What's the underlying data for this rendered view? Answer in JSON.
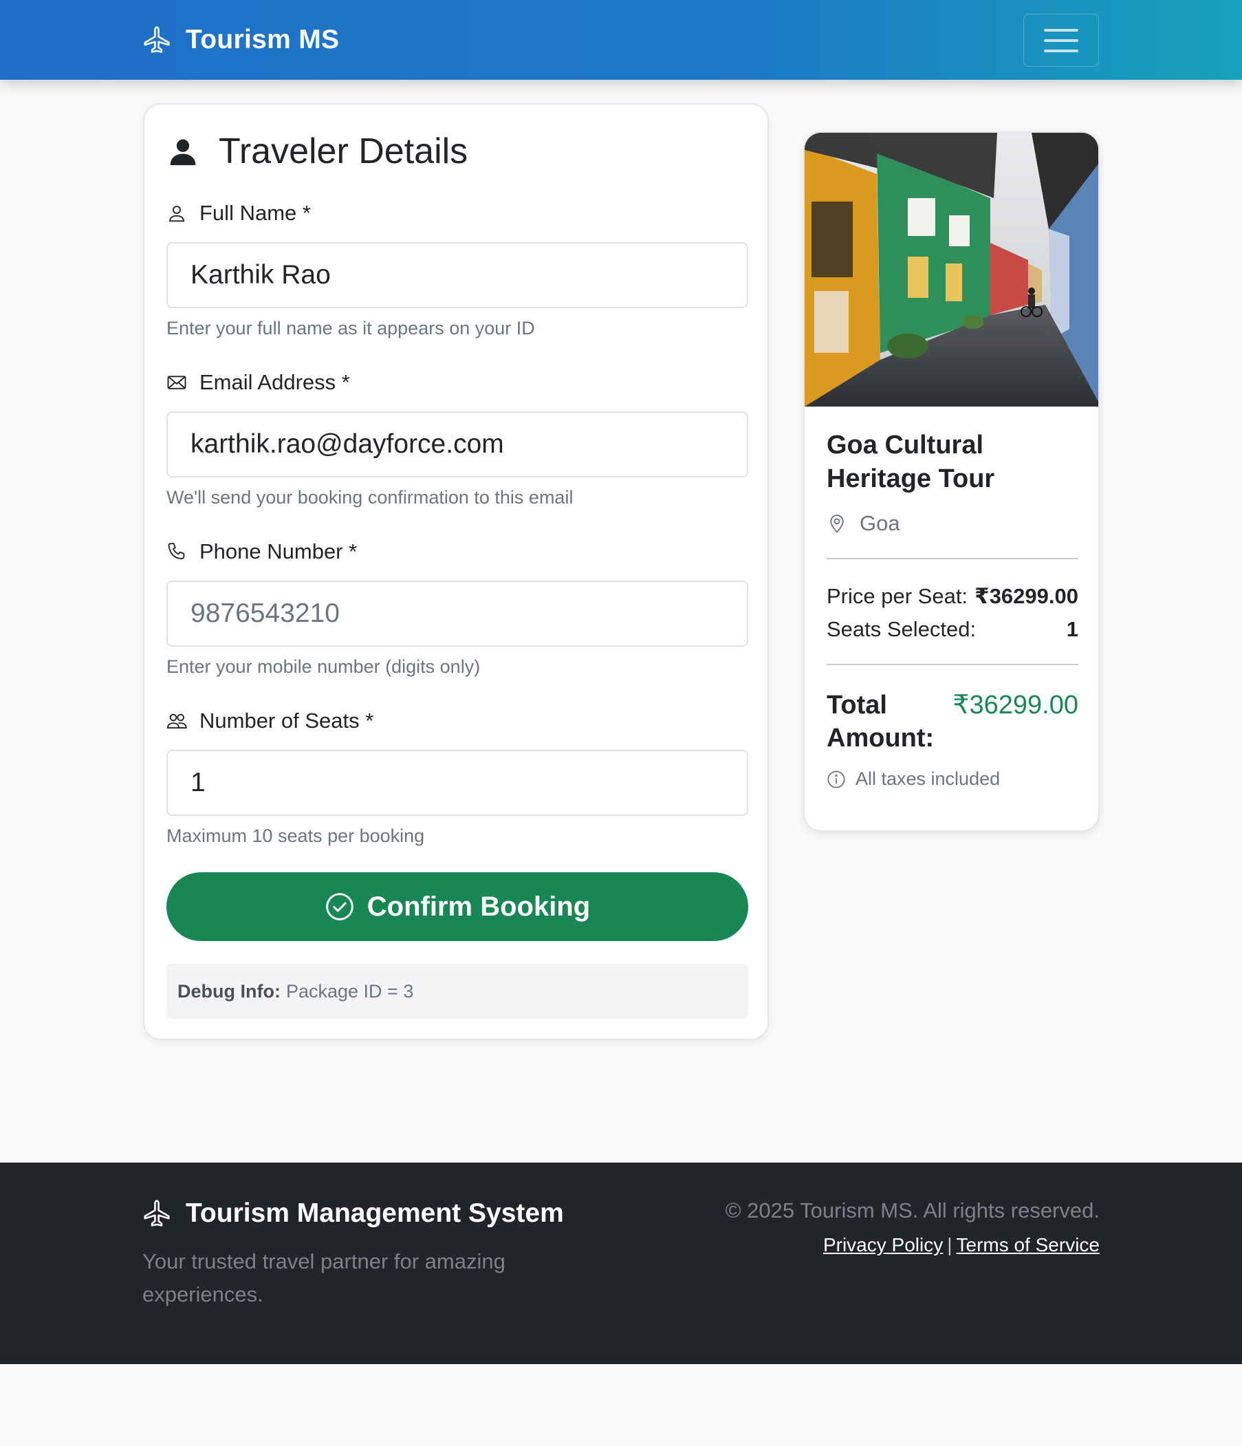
{
  "navbar": {
    "brand": "Tourism MS"
  },
  "form": {
    "title": "Traveler Details",
    "full_name": {
      "label": "Full Name *",
      "value": "Karthik Rao",
      "help": "Enter your full name as it appears on your ID"
    },
    "email": {
      "label": "Email Address *",
      "value": "karthik.rao@dayforce.com",
      "help": "We'll send your booking confirmation to this email"
    },
    "phone": {
      "label": "Phone Number *",
      "placeholder": "9876543210",
      "help": "Enter your mobile number (digits only)"
    },
    "seats": {
      "label": "Number of Seats *",
      "value": "1",
      "help": "Maximum 10 seats per booking"
    },
    "confirm_label": "Confirm Booking",
    "debug_label": "Debug Info:",
    "debug_text": "Package ID = 3"
  },
  "package": {
    "title": "Goa Cultural Heritage Tour",
    "location": "Goa",
    "price_label": "Price per Seat:",
    "price_value": "₹36299.00",
    "seats_label": "Seats Selected:",
    "seats_value": "1",
    "total_label": "Total Amount:",
    "total_value": "₹36299.00",
    "tax_note": "All taxes included"
  },
  "footer": {
    "brand": "Tourism Management System",
    "tagline": "Your trusted travel partner for amazing experiences.",
    "copyright": "© 2025 Tourism MS. All rights reserved.",
    "privacy": "Privacy Policy",
    "separator": "|",
    "terms": "Terms of Service"
  },
  "colors": {
    "primary": "#1f6fc7",
    "success": "#198754",
    "footer": "#212529"
  },
  "icons": [
    "airplane-icon",
    "menu-icon",
    "person-fill-icon",
    "person-icon",
    "envelope-icon",
    "phone-icon",
    "people-icon",
    "check-circle-icon",
    "geo-pin-icon",
    "info-circle-icon"
  ]
}
